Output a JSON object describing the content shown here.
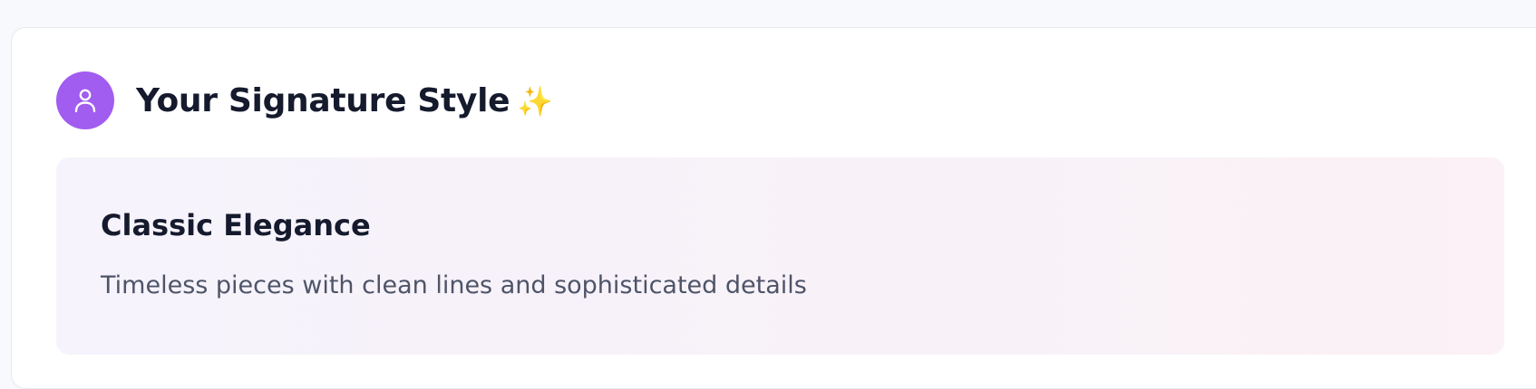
{
  "card": {
    "title": "Your Signature Style",
    "title_emoji": "✨",
    "avatar_icon": "user-icon"
  },
  "style": {
    "name": "Classic Elegance",
    "description": "Timeless pieces with clean lines and sophisticated details"
  },
  "colors": {
    "accent": "#a15cf0",
    "panel_from": "#f6f3fc",
    "panel_to": "#fbf1f6",
    "heading": "#151a2d",
    "body_text": "#4e5468",
    "sparkle": "#f3c53a"
  }
}
